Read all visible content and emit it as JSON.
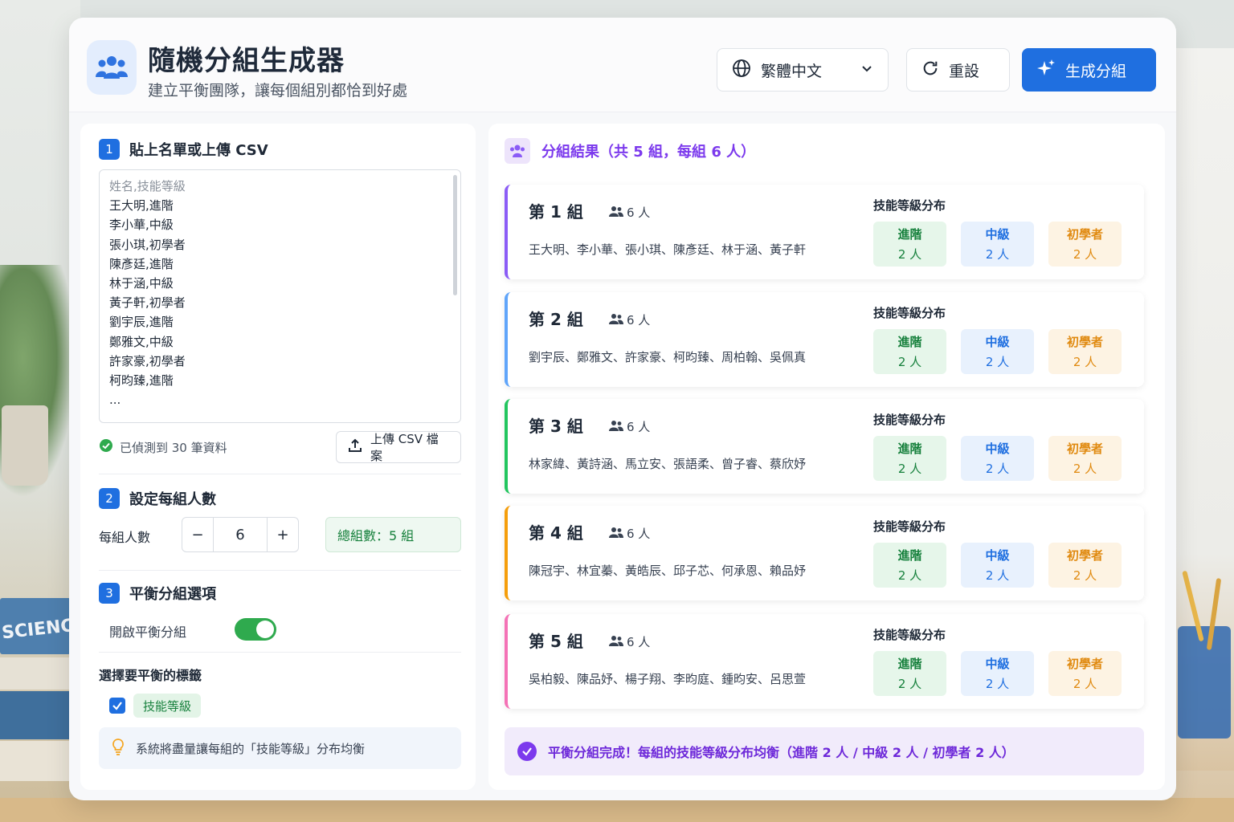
{
  "header": {
    "title": "隨機分組生成器",
    "subtitle": "建立平衡團隊，讓每個組別都恰到好處",
    "language": "繁體中文",
    "reset_label": "重設",
    "generate_label": "生成分組"
  },
  "input_panel": {
    "step1": {
      "number": "1",
      "title": "貼上名單或上傳 CSV"
    },
    "roster_placeholder": "姓名,技能等級",
    "roster_lines": [
      "王大明,進階",
      "李小華,中級",
      "張小琪,初學者",
      "陳彥廷,進階",
      "林于涵,中級",
      "黃子軒,初學者",
      "劉宇辰,進階",
      "鄭雅文,中級",
      "許家豪,初學者",
      "柯昀臻,進階",
      "..."
    ],
    "detected_text": "已偵測到 30 筆資料",
    "upload_label": "上傳 CSV 檔案",
    "step2": {
      "number": "2",
      "title": "設定每組人數"
    },
    "per_group_label": "每組人數",
    "per_group_value": "6",
    "minus_symbol": "−",
    "plus_symbol": "+",
    "total_groups_text": "總組數：5 組",
    "step3": {
      "number": "3",
      "title": "平衡分組選項"
    },
    "balance_toggle_label": "開啟平衡分組",
    "balance_toggle_on": true,
    "select_tags_label": "選擇要平衡的標籤",
    "tag_label": "技能等級",
    "tag_checked": true,
    "hint_text": "系統將盡量讓每組的「技能等級」分布均衡"
  },
  "results": {
    "title": "分組結果（共 5 組，每組 6 人）",
    "dist_label": "技能等級分布",
    "groups": [
      {
        "title": "第 1 組",
        "count": "6 人",
        "members": "王大明、李小華、張小琪、陳彥廷、林于涵、黃子軒",
        "accent": "#8b5cf6",
        "levels": [
          {
            "name": "進階",
            "count": "2 人"
          },
          {
            "name": "中級",
            "count": "2 人"
          },
          {
            "name": "初學者",
            "count": "2 人"
          }
        ]
      },
      {
        "title": "第 2 組",
        "count": "6 人",
        "members": "劉宇辰、鄭雅文、許家豪、柯昀臻、周柏翰、吳佩真",
        "accent": "#60a5fa",
        "levels": [
          {
            "name": "進階",
            "count": "2 人"
          },
          {
            "name": "中級",
            "count": "2 人"
          },
          {
            "name": "初學者",
            "count": "2 人"
          }
        ]
      },
      {
        "title": "第 3 組",
        "count": "6 人",
        "members": "林家緯、黃詩涵、馬立安、張語柔、曾子睿、蔡欣妤",
        "accent": "#22c55e",
        "levels": [
          {
            "name": "進階",
            "count": "2 人"
          },
          {
            "name": "中級",
            "count": "2 人"
          },
          {
            "name": "初學者",
            "count": "2 人"
          }
        ]
      },
      {
        "title": "第 4 組",
        "count": "6 人",
        "members": "陳冠宇、林宜蓁、黃皓辰、邱子芯、何承恩、賴品妤",
        "accent": "#f59e0b",
        "levels": [
          {
            "name": "進階",
            "count": "2 人"
          },
          {
            "name": "中級",
            "count": "2 人"
          },
          {
            "name": "初學者",
            "count": "2 人"
          }
        ]
      },
      {
        "title": "第 5 組",
        "count": "6 人",
        "members": "吳柏毅、陳品妤、楊子翔、李昀庭、鍾昀安、呂思萱",
        "accent": "#f472b6",
        "levels": [
          {
            "name": "進階",
            "count": "2 人"
          },
          {
            "name": "中級",
            "count": "2 人"
          },
          {
            "name": "初學者",
            "count": "2 人"
          }
        ]
      }
    ],
    "done_text": "平衡分組完成！每組的技能等級分布均衡（進階 2 人 / 中級 2 人 / 初學者 2 人）"
  },
  "colors": {
    "primary": "#1f6fe0",
    "success": "#2faa4e",
    "purple": "#7c3aed"
  }
}
